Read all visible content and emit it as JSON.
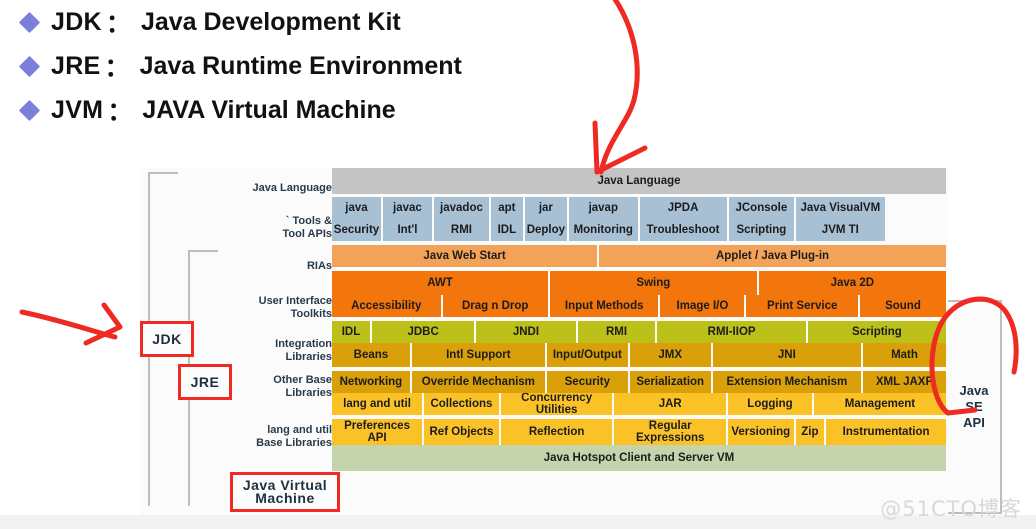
{
  "bullets": [
    {
      "key": "JDK",
      "colon": "：",
      "value": "Java Development Kit"
    },
    {
      "key": "JRE",
      "colon": "：",
      "value": "Java Runtime Environment"
    },
    {
      "key": "JVM",
      "colon": "：",
      "value": "JAVA Virtual Machine"
    }
  ],
  "diagram": {
    "brackets": [
      {
        "label": "JDK"
      },
      {
        "label": "JRE"
      }
    ],
    "jvm_tag": "Java Virtual\nMachine",
    "jvm_tag_line1": "Java Virtual",
    "jvm_tag_line2": "Machine",
    "se_api_label": "Java\nSE\nAPI",
    "se_api_line1": "Java",
    "se_api_line2": "SE",
    "se_api_line3": "API",
    "row_labels": [
      {
        "lines": [
          "Java Language"
        ]
      },
      {
        "lines": [
          "` Tools &",
          "Tool APIs"
        ]
      },
      {
        "lines": [
          "RIAs"
        ]
      },
      {
        "lines": [
          "User Interface",
          "Toolkits"
        ]
      },
      {
        "lines": [
          "Integration",
          "Libraries"
        ]
      },
      {
        "lines": [
          "Other Base",
          "Libraries"
        ]
      },
      {
        "lines": [
          "lang and util",
          "Base Libraries"
        ]
      },
      {
        "lines": [
          "Java Virtual",
          "Machine"
        ]
      }
    ],
    "bands": [
      {
        "name": "java-language",
        "color": "c-gray",
        "cells": [
          {
            "text": "Java Language",
            "flex": 100
          }
        ]
      },
      {
        "name": "tools-row-1",
        "color": "c-blue",
        "cells": [
          {
            "text": "java",
            "flex": 8.3
          },
          {
            "text": "javac",
            "flex": 8.3
          },
          {
            "text": "javadoc",
            "flex": 9.3
          },
          {
            "text": "apt",
            "flex": 5.5
          },
          {
            "text": "jar",
            "flex": 7.2
          },
          {
            "text": "javap",
            "flex": 11.5
          },
          {
            "text": "JPDA",
            "flex": 14.5
          },
          {
            "text": "JConsole",
            "flex": 11.0
          },
          {
            "text": "Java VisualVM",
            "flex": 14.4
          }
        ]
      },
      {
        "name": "tools-row-2",
        "color": "c-blue",
        "cells": [
          {
            "text": "Security",
            "flex": 8.3
          },
          {
            "text": "Int'l",
            "flex": 8.3
          },
          {
            "text": "RMI",
            "flex": 9.3
          },
          {
            "text": "IDL",
            "flex": 5.5
          },
          {
            "text": "Deploy",
            "flex": 7.2
          },
          {
            "text": "Monitoring",
            "flex": 11.5
          },
          {
            "text": "Troubleshoot",
            "flex": 14.5
          },
          {
            "text": "Scripting",
            "flex": 11.0
          },
          {
            "text": "JVM TI",
            "flex": 14.4
          }
        ]
      },
      {
        "name": "rias",
        "color": "c-lorng",
        "cells": [
          {
            "text": "Java Web Start",
            "flex": 43.5
          },
          {
            "text": "Applet / Java Plug-in",
            "flex": 56.5
          }
        ]
      },
      {
        "name": "ui-toolkits-row-1",
        "color": "c-orng",
        "cells": [
          {
            "text": "AWT",
            "flex": 35.5
          },
          {
            "text": "Swing",
            "flex": 34.0
          },
          {
            "text": "Java 2D",
            "flex": 30.5
          }
        ]
      },
      {
        "name": "ui-toolkits-row-2",
        "color": "c-orng",
        "cells": [
          {
            "text": "Accessibility",
            "flex": 18.0
          },
          {
            "text": "Drag n Drop",
            "flex": 17.5
          },
          {
            "text": "Input Methods",
            "flex": 18.0
          },
          {
            "text": "Image I/O",
            "flex": 14.0
          },
          {
            "text": "Print Service",
            "flex": 18.5
          },
          {
            "text": "Sound",
            "flex": 14.0
          }
        ]
      },
      {
        "name": "integration-libraries",
        "color": "c-olive",
        "cells": [
          {
            "text": "IDL",
            "flex": 6.5
          },
          {
            "text": "JDBC",
            "flex": 17.0
          },
          {
            "text": "JNDI",
            "flex": 16.5
          },
          {
            "text": "RMI",
            "flex": 13.0
          },
          {
            "text": "RMI-IIOP",
            "flex": 24.5
          },
          {
            "text": "Scripting",
            "flex": 22.5
          }
        ]
      },
      {
        "name": "other-base-row-1",
        "color": "c-gold",
        "cells": [
          {
            "text": "Beans",
            "flex": 13.0
          },
          {
            "text": "Intl Support",
            "flex": 22.0
          },
          {
            "text": "Input/Output",
            "flex": 13.5
          },
          {
            "text": "JMX",
            "flex": 13.5
          },
          {
            "text": "JNI",
            "flex": 24.5
          },
          {
            "text": "Math",
            "flex": 13.5
          }
        ]
      },
      {
        "name": "other-base-row-2",
        "color": "c-gold",
        "cells": [
          {
            "text": "Networking",
            "flex": 13.0
          },
          {
            "text": "Override Mechanism",
            "flex": 22.0
          },
          {
            "text": "Security",
            "flex": 13.5
          },
          {
            "text": "Serialization",
            "flex": 13.5
          },
          {
            "text": "Extension Mechanism",
            "flex": 24.5
          },
          {
            "text": "XML JAXP",
            "flex": 13.5
          }
        ]
      },
      {
        "name": "lang-util-row-1",
        "color": "c-amber",
        "cells": [
          {
            "text": "lang and util",
            "flex": 15.0
          },
          {
            "text": "Collections",
            "flex": 12.5
          },
          {
            "text": "Concurrency Utilities",
            "flex": 18.5
          },
          {
            "text": "JAR",
            "flex": 18.5
          },
          {
            "text": "Logging",
            "flex": 14.0
          },
          {
            "text": "Management",
            "flex": 21.5
          }
        ]
      },
      {
        "name": "lang-util-row-2",
        "color": "c-amber",
        "cells": [
          {
            "text": "Preferences API",
            "flex": 15.0
          },
          {
            "text": "Ref Objects",
            "flex": 12.5
          },
          {
            "text": "Reflection",
            "flex": 18.5
          },
          {
            "text": "Regular Expressions",
            "flex": 18.5
          },
          {
            "text": "Versioning",
            "flex": 11.0
          },
          {
            "text": "Zip",
            "flex": 5.0
          },
          {
            "text": "Instrumentation",
            "flex": 19.5
          }
        ]
      },
      {
        "name": "hotspot-vm",
        "color": "c-sage",
        "cells": [
          {
            "text": "Java Hotspot Client and Server VM",
            "flex": 100
          }
        ]
      }
    ]
  },
  "annotations": {
    "arrow_top_target": "Java Language",
    "arrow_left_target": "JDK",
    "circle_right_target": "Java SE API"
  },
  "watermark": "@51CTO博客",
  "colors": {
    "bullet_diamond": "#7a7fdc",
    "annotation_red": "#ee2a22",
    "java_language": "#c4c4c4",
    "tools": "#a8c0d4",
    "rias": "#f2a358",
    "ui_toolkits": "#f2760c",
    "integration": "#bcc018",
    "other_base": "#d9a009",
    "lang_util": "#fbc228",
    "jvm": "#c6d4ae"
  }
}
